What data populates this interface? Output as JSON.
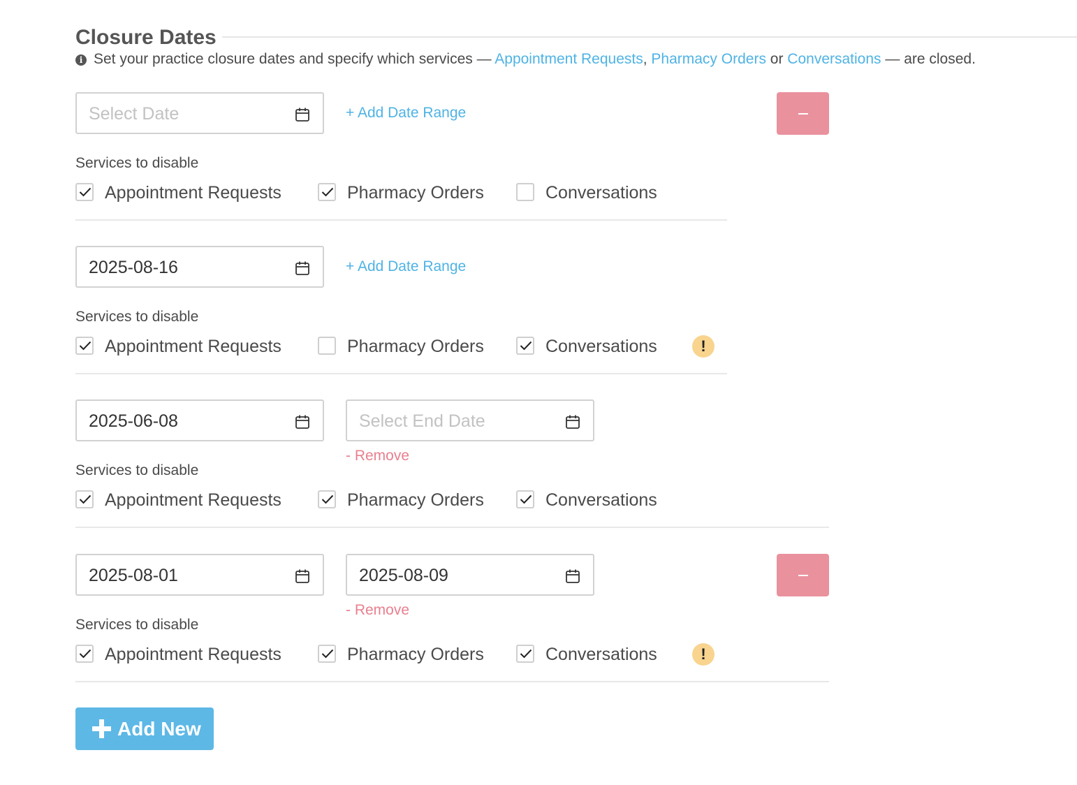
{
  "header": {
    "title": "Closure Dates",
    "subtitle_prefix": "Set your practice closure dates and specify which services — ",
    "subtitle_link1": "Appointment Requests",
    "subtitle_sep1": ", ",
    "subtitle_link2": "Pharmacy Orders",
    "subtitle_sep2": " or ",
    "subtitle_link3": "Conversations",
    "subtitle_suffix": " — are closed."
  },
  "labels": {
    "add_date_range": "+ Add Date Range",
    "remove": "- Remove",
    "services_to_disable": "Services to disable",
    "appointment_requests": "Appointment Requests",
    "pharmacy_orders": "Pharmacy Orders",
    "conversations": "Conversations",
    "warning_glyph": "!",
    "add_new": "Add New"
  },
  "colors": {
    "accent": "#4fb3e4",
    "danger": "#ea919e",
    "remove_text": "#e8808f",
    "warning": "#f8d48f",
    "add_new_bg": "#5db8e6"
  },
  "entries": [
    {
      "start_date": "",
      "start_placeholder": "Select Date",
      "end_date": null,
      "has_remove_button": true,
      "services": {
        "appointment_requests": true,
        "pharmacy_orders": true,
        "conversations": false
      },
      "warning": false
    },
    {
      "start_date": "2025-08-16",
      "start_placeholder": "Select Date",
      "end_date": null,
      "has_remove_button": false,
      "services": {
        "appointment_requests": true,
        "pharmacy_orders": false,
        "conversations": true
      },
      "warning": true
    },
    {
      "start_date": "2025-06-08",
      "start_placeholder": "Select Date",
      "end_date": "",
      "end_placeholder": "Select End Date",
      "has_remove_button": false,
      "services": {
        "appointment_requests": true,
        "pharmacy_orders": true,
        "conversations": true
      },
      "warning": false
    },
    {
      "start_date": "2025-08-01",
      "start_placeholder": "Select Date",
      "end_date": "2025-08-09",
      "end_placeholder": "Select End Date",
      "has_remove_button": true,
      "services": {
        "appointment_requests": true,
        "pharmacy_orders": true,
        "conversations": true
      },
      "warning": true
    }
  ]
}
